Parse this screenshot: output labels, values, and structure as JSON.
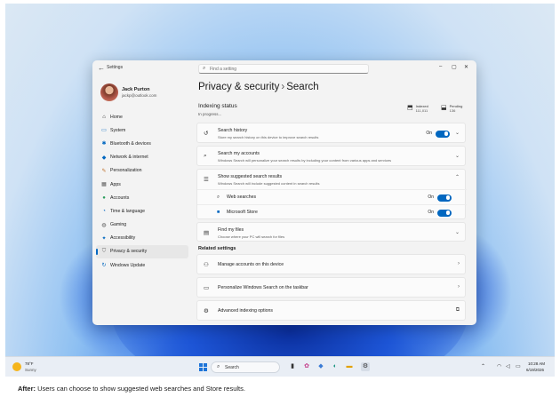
{
  "window": {
    "app_title": "Settings",
    "search_placeholder": "Find a setting"
  },
  "profile": {
    "name": "Jack Purton",
    "email": "jackp@outlook.com"
  },
  "sidebar": {
    "items": [
      {
        "label": "Home",
        "icon": "home-icon"
      },
      {
        "label": "System",
        "icon": "monitor-icon"
      },
      {
        "label": "Bluetooth & devices",
        "icon": "bluetooth-icon"
      },
      {
        "label": "Network & internet",
        "icon": "wifi-icon"
      },
      {
        "label": "Personalization",
        "icon": "brush-icon"
      },
      {
        "label": "Apps",
        "icon": "apps-icon"
      },
      {
        "label": "Accounts",
        "icon": "person-icon"
      },
      {
        "label": "Time & language",
        "icon": "globe-clock-icon"
      },
      {
        "label": "Gaming",
        "icon": "gamepad-icon"
      },
      {
        "label": "Accessibility",
        "icon": "accessibility-icon"
      },
      {
        "label": "Privacy & security",
        "icon": "shield-icon",
        "active": true
      },
      {
        "label": "Windows Update",
        "icon": "update-icon"
      }
    ]
  },
  "page": {
    "breadcrumb_parent": "Privacy & security",
    "breadcrumb_sep": "›",
    "title": "Search"
  },
  "indexing": {
    "title": "Indexing status",
    "status": "In progress...",
    "indexed_label": "Indexed",
    "indexed_value": "111,011",
    "pending_label": "Pending",
    "pending_value": "136"
  },
  "cards": {
    "history": {
      "title": "Search history",
      "desc": "Store my search history on this device to improve search results",
      "state": "On"
    },
    "accounts": {
      "title": "Search my accounts",
      "desc": "Windows Search will personalize your search results by including your content from various apps and services"
    },
    "suggested": {
      "title": "Show suggested search results",
      "desc": "Windows Search will include suggested content in search results",
      "web_label": "Web searches",
      "web_state": "On",
      "store_label": "Microsoft Store",
      "store_state": "On"
    },
    "files": {
      "title": "Find my files",
      "desc": "Choose where your PC will search for files"
    }
  },
  "related": {
    "heading": "Related settings",
    "manage_accounts": "Manage accounts on this device",
    "personalize": "Personalize Windows Search on the taskbar",
    "advanced": "Advanced indexing options"
  },
  "taskbar": {
    "weather_temp": "78°F",
    "weather_desc": "Sunny",
    "search_label": "Search",
    "time": "10:28 AM",
    "date": "6/19/2026"
  },
  "caption": {
    "bold": "After:",
    "text": " Users can choose to show suggested web searches and Store results."
  },
  "colors": {
    "accent": "#0067c0",
    "window_bg": "#f3f3f3",
    "card_bg": "#fbfbfb"
  }
}
